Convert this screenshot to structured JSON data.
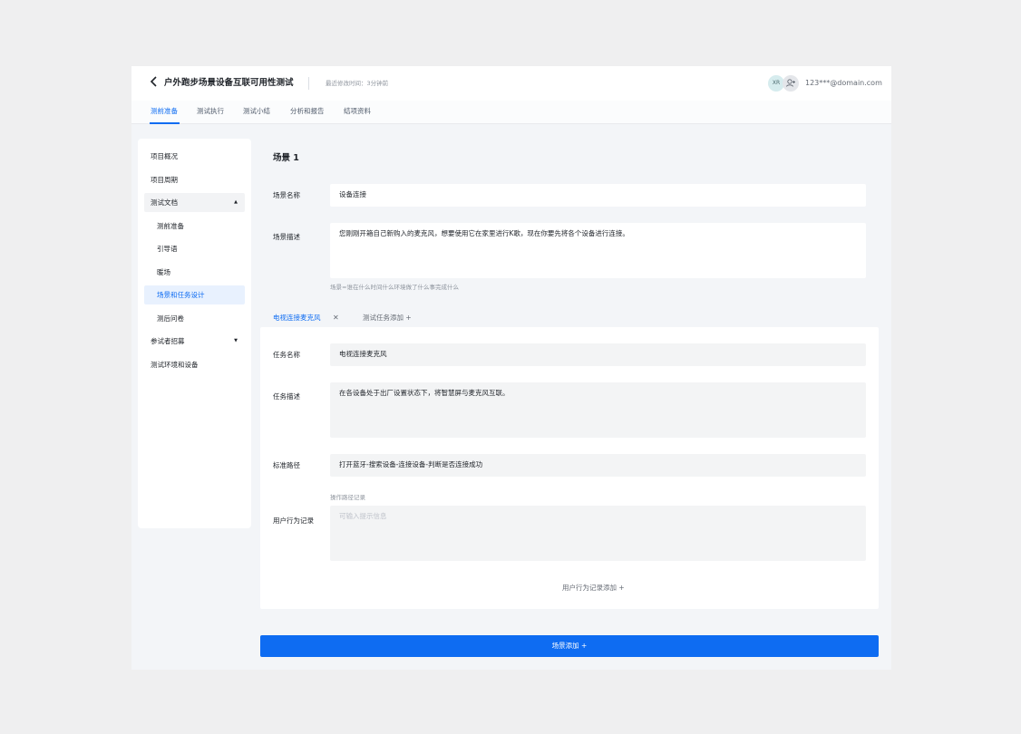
{
  "header": {
    "back_icon": "chevron-left-icon",
    "title": "户外跑步场景设备互联可用性测试",
    "modified": "最近修改时间：3分钟前",
    "avatar_initials": "XR",
    "add_user_icon": "add-user-icon",
    "email": "123***@domain.com"
  },
  "tabs": [
    "测前准备",
    "测试执行",
    "测试小结",
    "分析和报告",
    "结项资料"
  ],
  "sidebar": {
    "items": [
      "项目概况",
      "项目周期",
      "测试文档",
      "测前准备",
      "引导语",
      "暖场",
      "场景和任务设计",
      "测后问卷",
      "参试者招募",
      "测试环境和设备"
    ]
  },
  "scene": {
    "title": "场景 1",
    "name_label": "场景名称",
    "name_value": "设备连接",
    "desc_label": "场景描述",
    "desc_value": "您刚刚开箱自己新购入的麦克风，想要使用它在家里进行K歌，现在你要先将各个设备进行连接。",
    "desc_hint": "场景=谁在什么时间什么环境做了什么事完成什么"
  },
  "task_tabs": {
    "active": "电视连接麦克风",
    "add_label": "测试任务添加  +"
  },
  "task": {
    "name_label": "任务名称",
    "name_value": "电视连接麦克风",
    "desc_label": "任务描述",
    "desc_value": "在各设备处于出厂设置状态下，将智慧屏与麦克风互联。",
    "path_label": "标准路径",
    "path_value": "打开蓝牙-搜索设备-连接设备-判断是否连接成功",
    "record_hint": "操作路径记录",
    "record_label": "用户行为记录",
    "record_placeholder": "可输入提示信息",
    "record_add": "用户行为记录添加  +"
  },
  "scene_add_button": "场景添加  +",
  "colors": {
    "accent": "#0e6cf2",
    "page_bg": "#efeff0",
    "panel_bg": "#f3f5f8"
  }
}
